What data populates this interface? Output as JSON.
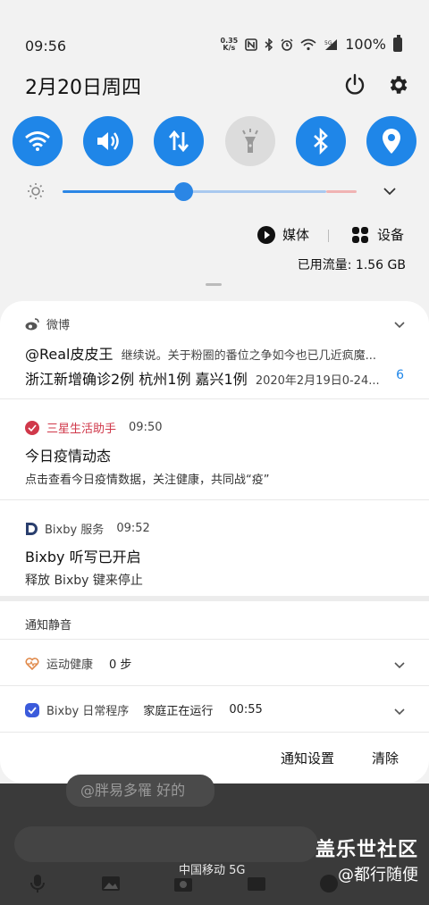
{
  "status_bar": {
    "time": "09:56",
    "net_speed_value": "0.35",
    "net_speed_unit": "K/s",
    "battery_percent": "100%"
  },
  "header": {
    "date": "2月20日周四"
  },
  "quick_settings": [
    {
      "name": "wifi",
      "icon": "wifi-icon",
      "on": true
    },
    {
      "name": "sound",
      "icon": "volume-icon",
      "on": true
    },
    {
      "name": "mobile-data",
      "icon": "data-arrows-icon",
      "on": true
    },
    {
      "name": "flashlight",
      "icon": "flashlight-icon",
      "on": false
    },
    {
      "name": "bluetooth",
      "icon": "bluetooth-icon",
      "on": true
    },
    {
      "name": "location",
      "icon": "location-icon",
      "on": true
    }
  ],
  "brightness": {
    "level": 0.36
  },
  "media": {
    "media_label": "媒体",
    "devices_label": "设备"
  },
  "data_usage": "已用流量: 1.56 GB",
  "notifications": [
    {
      "app": "微博",
      "title": "@Real皮皮王",
      "title_rest": "继续说。关于粉圈的番位之争如今也已几近疯魔...",
      "body": "浙江新增确诊2例 杭州1例 嘉兴1例",
      "body_rest": "2020年2月19日0-24...",
      "count": "6"
    },
    {
      "app": "三星生活助手",
      "time": "09:50",
      "title": "今日疫情动态",
      "body": "点击查看今日疫情数据，关注健康，共同战“疫”"
    },
    {
      "app": "Bixby 服务",
      "time": "09:52",
      "title": "Bixby 听写已开启",
      "body": "释放 Bixby 键来停止"
    }
  ],
  "silent_section": {
    "label": "通知静音",
    "items": [
      {
        "app": "运动健康",
        "text": "0 步"
      },
      {
        "app": "Bixby 日常程序",
        "text": "家庭正在运行",
        "time": "00:55"
      }
    ]
  },
  "footer": {
    "settings_label": "通知设置",
    "clear_label": "清除"
  },
  "background": {
    "chat_text": "@胖易多罹 好的",
    "carrier": "中国移动 5G",
    "watermark_title": "盖乐世社区",
    "watermark_user": "@都行随便"
  },
  "colors": {
    "accent": "#1f86e8",
    "samsung_life": "#d0384a",
    "panel_bg": "#f2f2f2"
  }
}
